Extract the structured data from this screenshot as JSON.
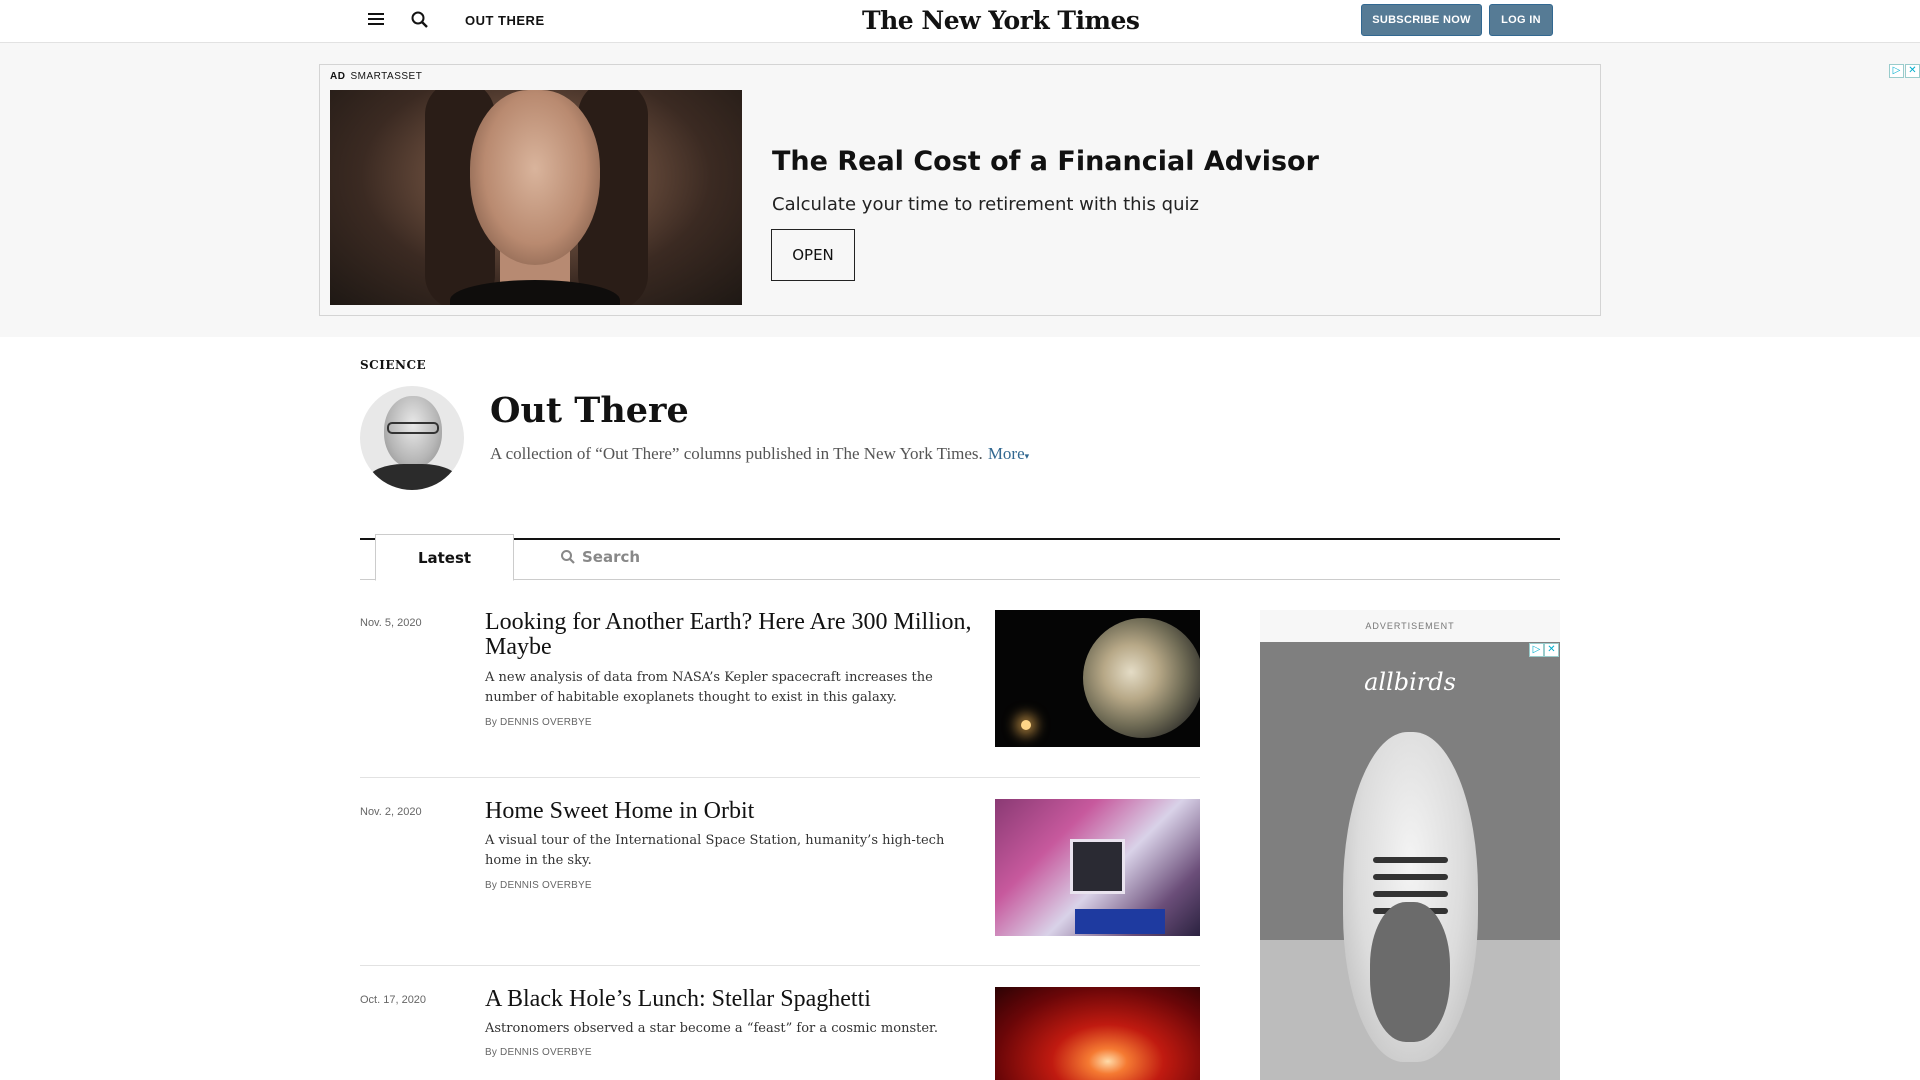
{
  "header": {
    "section_name": "OUT THERE",
    "logo": "The New York Times",
    "subscribe_label": "SUBSCRIBE NOW",
    "login_label": "LOG IN",
    "accent_color": "#567b95"
  },
  "top_ad": {
    "ad_tag": "AD",
    "advertiser": "SMARTASSET",
    "headline": "The Real Cost of a Financial Advisor",
    "subhead": "Calculate your time to retirement with this quiz",
    "cta_label": "OPEN"
  },
  "column": {
    "kicker": "SCIENCE",
    "title": "Out There",
    "description": "A collection of “Out There” columns published in The New York Times.",
    "more_label": "More"
  },
  "tabs": {
    "latest_label": "Latest",
    "search_placeholder": "Search"
  },
  "articles": [
    {
      "date": "Nov. 5, 2020",
      "title": "Looking for Another Earth? Here Are 300 Million, Maybe",
      "summary": "A new analysis of data from NASA’s Kepler spacecraft increases the number of habitable exoplanets thought to exist in this galaxy.",
      "byline": "By DENNIS OVERBYE"
    },
    {
      "date": "Nov. 2, 2020",
      "title": "Home Sweet Home in Orbit",
      "summary": "A visual tour of the International Space Station, humanity’s high-tech home in the sky.",
      "byline": "By DENNIS OVERBYE"
    },
    {
      "date": "Oct. 17, 2020",
      "title": "A Black Hole’s Lunch: Stellar Spaghetti",
      "summary": "Astronomers observed a star become a “feast” for a cosmic monster.",
      "byline": "By DENNIS OVERBYE"
    }
  ],
  "side_ad": {
    "label": "ADVERTISEMENT",
    "brand": "allbirds"
  },
  "icons": {
    "menu": "menu-icon",
    "search": "search-icon",
    "adchoices": "adchoices-icon",
    "close": "close-icon"
  }
}
